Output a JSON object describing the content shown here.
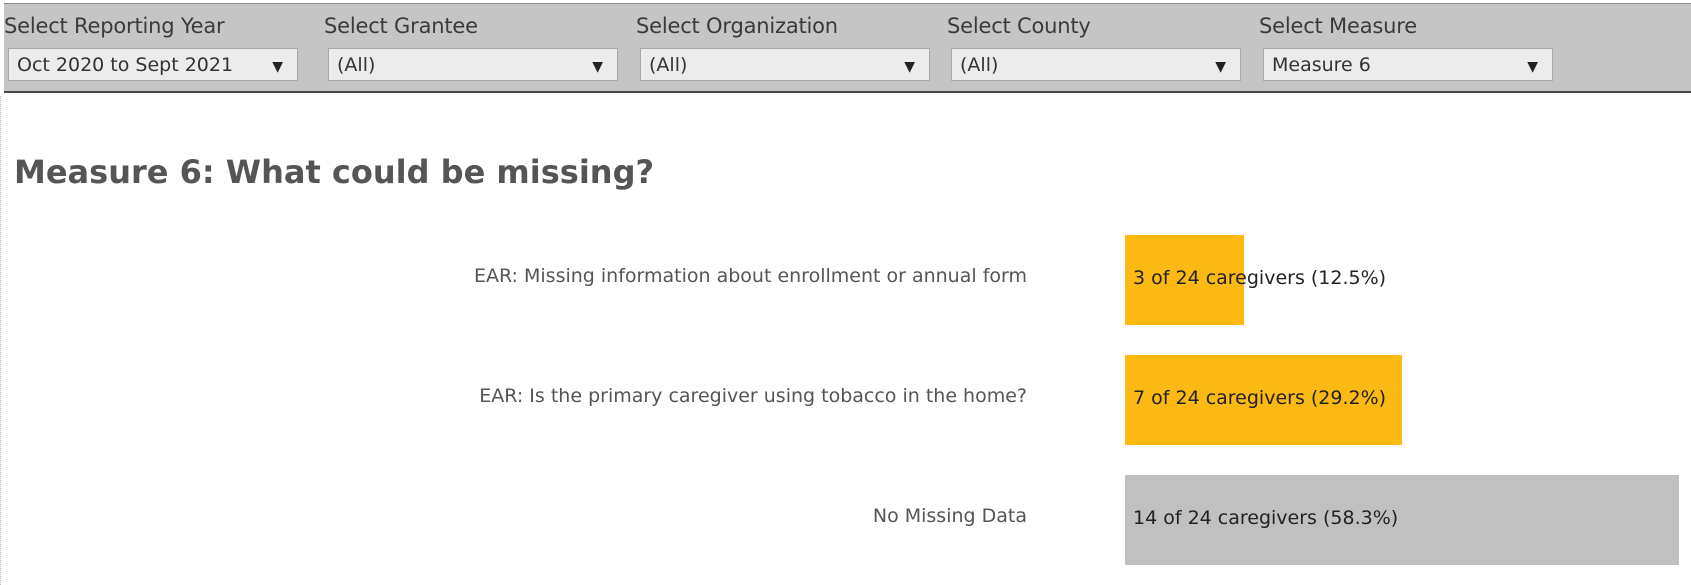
{
  "filters": [
    {
      "label": "Select Reporting Year",
      "value": "Oct 2020 to Sept 2021"
    },
    {
      "label": "Select Grantee",
      "value": "(All)"
    },
    {
      "label": "Select Organization",
      "value": "(All)"
    },
    {
      "label": "Select County",
      "value": "(All)"
    },
    {
      "label": "Select Measure",
      "value": "Measure 6"
    }
  ],
  "dropdown_icon": "▼",
  "title": "Measure 6: What could be missing?",
  "chart_data": {
    "type": "bar",
    "orientation": "horizontal",
    "categories": [
      "EAR: Missing information about enrollment or annual form",
      "EAR: Is the primary caregiver using tobacco in the home?",
      "No Missing Data"
    ],
    "values": [
      12.5,
      29.2,
      58.3
    ],
    "data_labels": [
      "3 of 24 caregivers (12.5%)",
      "7 of 24 caregivers (29.2%)",
      "14 of 24 caregivers (58.3%)"
    ],
    "colors": [
      "#FDB913",
      "#FDB913",
      "#C0C0C0"
    ],
    "unit": "percent",
    "grid": false
  }
}
